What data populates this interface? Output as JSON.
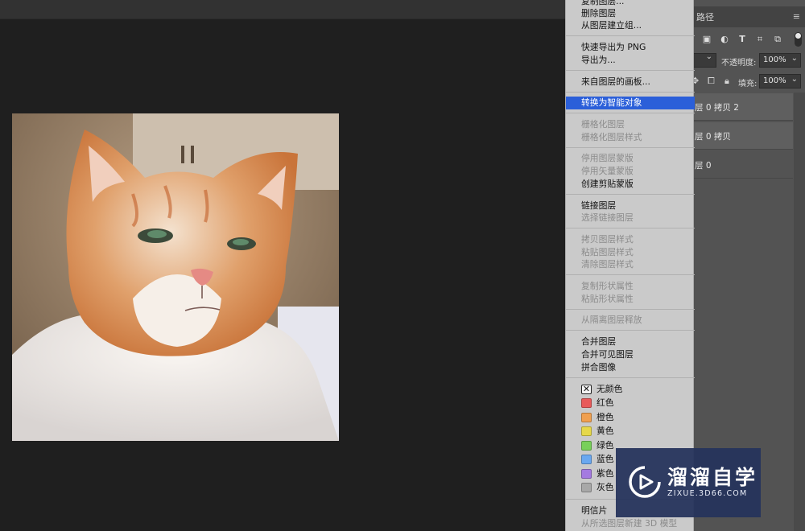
{
  "layers_panel": {
    "tab_label": "路径",
    "menu_icon": "hamburger-menu-icon",
    "filter_icons": [
      "image-filter-icon",
      "adjustment-filter-icon",
      "type-filter-icon",
      "shape-filter-icon",
      "smart-object-filter-icon"
    ],
    "opacity_label": "不透明度:",
    "opacity_value": "100%",
    "fill_label": "填充:",
    "fill_value": "100%",
    "layers": [
      {
        "name": "层 0 拷贝 2",
        "selected": true
      },
      {
        "name": "层 0 拷贝",
        "selected": true
      },
      {
        "name": "层 0",
        "selected": false
      }
    ]
  },
  "context_menu": {
    "items": [
      {
        "label": "复制图层...",
        "state": "enabled"
      },
      {
        "label": "删除图层",
        "state": "enabled"
      },
      {
        "label": "从图层建立组...",
        "state": "enabled"
      },
      {
        "label": "快速导出为 PNG",
        "state": "enabled"
      },
      {
        "label": "导出为...",
        "state": "enabled"
      },
      {
        "label": "来自图层的画板...",
        "state": "enabled"
      },
      {
        "label": "转换为智能对象",
        "state": "highlighted"
      },
      {
        "label": "栅格化图层",
        "state": "disabled"
      },
      {
        "label": "栅格化图层样式",
        "state": "disabled"
      },
      {
        "label": "停用图层蒙版",
        "state": "disabled"
      },
      {
        "label": "停用矢量蒙版",
        "state": "disabled"
      },
      {
        "label": "创建剪贴蒙版",
        "state": "enabled"
      },
      {
        "label": "链接图层",
        "state": "enabled"
      },
      {
        "label": "选择链接图层",
        "state": "disabled"
      },
      {
        "label": "拷贝图层样式",
        "state": "disabled"
      },
      {
        "label": "粘贴图层样式",
        "state": "disabled"
      },
      {
        "label": "清除图层样式",
        "state": "disabled"
      },
      {
        "label": "复制形状属性",
        "state": "disabled"
      },
      {
        "label": "粘贴形状属性",
        "state": "disabled"
      },
      {
        "label": "从隔离图层释放",
        "state": "disabled"
      },
      {
        "label": "合并图层",
        "state": "enabled"
      },
      {
        "label": "合并可见图层",
        "state": "enabled"
      },
      {
        "label": "拼合图像",
        "state": "enabled"
      }
    ],
    "colors": [
      {
        "label": "无颜色",
        "color": "none"
      },
      {
        "label": "红色",
        "color": "#e85a5a"
      },
      {
        "label": "橙色",
        "color": "#f0a050"
      },
      {
        "label": "黄色",
        "color": "#e6d84a"
      },
      {
        "label": "绿色",
        "color": "#78d05a"
      },
      {
        "label": "蓝色",
        "color": "#6aa8f0"
      },
      {
        "label": "紫色",
        "color": "#a47ae0"
      },
      {
        "label": "灰色",
        "color": "#a8a8a8"
      }
    ],
    "footer_items": [
      {
        "label": "明信片",
        "state": "enabled"
      },
      {
        "label": "从所选图层新建 3D 模型",
        "state": "disabled"
      }
    ],
    "highlight_color": "#2b5fd9"
  },
  "watermark": {
    "title": "溜溜自学",
    "subtitle": "ZIXUE.3D66.COM"
  }
}
